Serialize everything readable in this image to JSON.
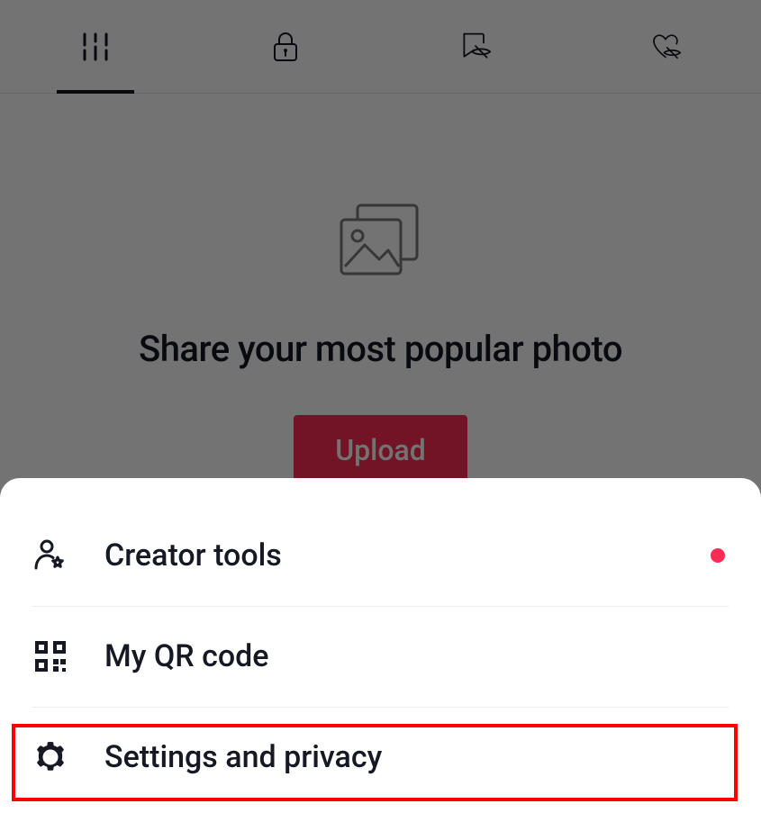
{
  "empty_state": {
    "headline": "Share your most popular photo",
    "upload_label": "Upload"
  },
  "sheet": {
    "items": [
      {
        "label": "Creator tools",
        "has_dot": true
      },
      {
        "label": "My QR code",
        "has_dot": false
      },
      {
        "label": "Settings and privacy",
        "has_dot": false
      }
    ]
  },
  "colors": {
    "accent": "#fe2c55",
    "highlight": "#ff0000"
  }
}
